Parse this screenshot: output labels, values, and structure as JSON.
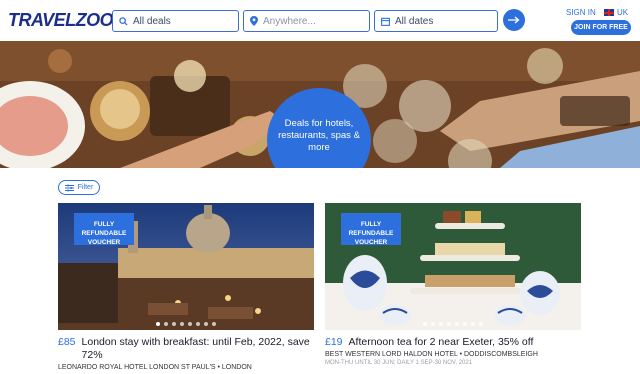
{
  "header": {
    "logo": "TRAVELZOO",
    "deals_value": "All deals",
    "where_placeholder": "Anywhere...",
    "dates_value": "All dates",
    "signin": "SIGN IN",
    "region": "UK",
    "join": "JOIN FOR FREE"
  },
  "hero": {
    "tagline": "Deals for hotels, restaurants, spas & more",
    "social": [
      "f",
      "t",
      "✉"
    ]
  },
  "filter": {
    "label": "Filter"
  },
  "cards": [
    {
      "badge": "FULLY REFUNDABLE VOUCHER",
      "price": "£85",
      "title": "London stay with breakfast: until Feb, 2022, save 72%",
      "subtitle": "LEONARDO ROYAL HOTEL LONDON ST PAUL'S • LONDON",
      "meta": ""
    },
    {
      "badge": "FULLY REFUNDABLE VOUCHER",
      "price": "£19",
      "title": "Afternoon tea for 2 near Exeter, 35% off",
      "subtitle": "BEST WESTERN LORD HALDON HOTEL • DODDISCOMBSLEIGH",
      "meta": "MON-THU UNTIL 30 JUN; DAILY 1 SEP-30 NOV, 2021"
    }
  ],
  "colors": {
    "brand": "#2d6fdc",
    "logo": "#1c2e8c"
  }
}
